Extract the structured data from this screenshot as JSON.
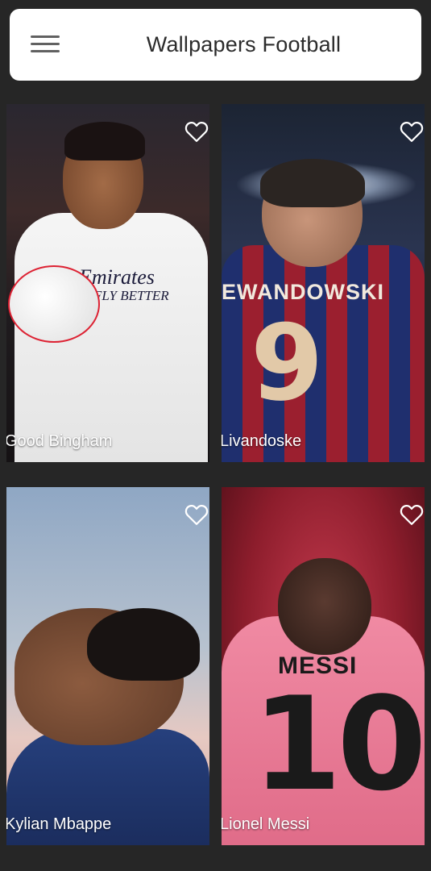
{
  "app_bar": {
    "title": "Wallpapers Football",
    "menu_icon": "hamburger-menu-icon"
  },
  "wallpapers": [
    {
      "label": "Good Bingham",
      "favorite_icon": "heart-outline-icon"
    },
    {
      "label": "Livandoske",
      "favorite_icon": "heart-outline-icon"
    },
    {
      "label": "Kylian Mbappe",
      "favorite_icon": "heart-outline-icon"
    },
    {
      "label": "Lionel Messi",
      "favorite_icon": "heart-outline-icon"
    }
  ],
  "photo_text": {
    "card1_sponsor": "Emirates",
    "card1_sponsor_tagline": "FLY BETTER",
    "card2_shirt_name": "EWANDOWSKI",
    "card2_shirt_number": "9",
    "card4_shirt_name": "MESSI",
    "card4_shirt_number": "10"
  },
  "colors": {
    "background": "#262626",
    "app_bar": "#ffffff",
    "title_text": "#2b2b2b",
    "card_label": "#ffffff"
  }
}
